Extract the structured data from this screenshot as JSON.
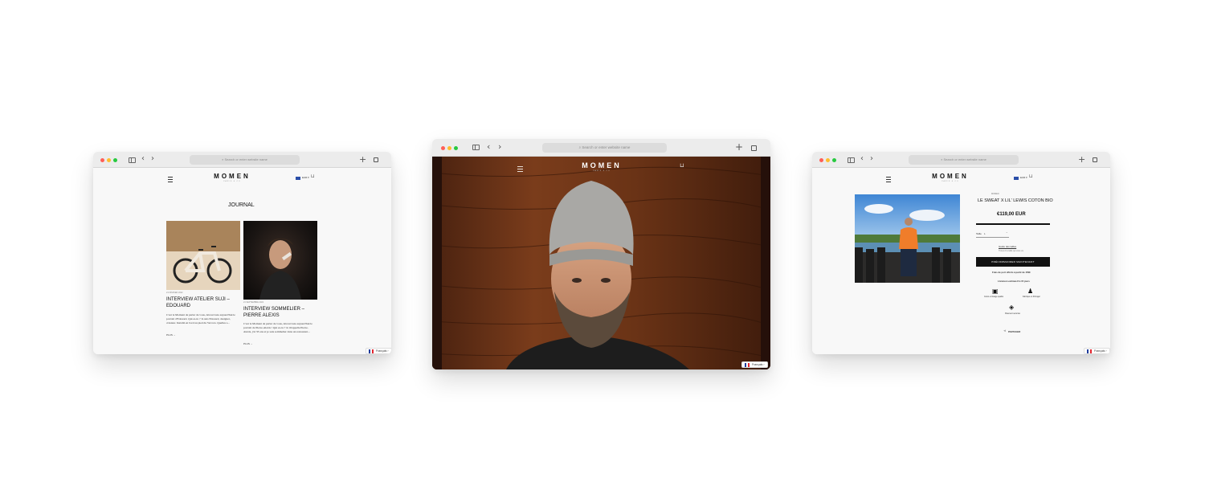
{
  "browser": {
    "url_placeholder": "Search or enter website name",
    "back_icon": "chevron-left-icon",
    "forward_icon": "chevron-right-icon",
    "new_tab_icon": "plus-icon",
    "tabs_icon": "tabs-overview-icon"
  },
  "brand": {
    "name": "MOMEN",
    "tagline": "PARIS & CO"
  },
  "header": {
    "currency": "EUR ▾"
  },
  "language": {
    "label": "Français",
    "chevron": "›"
  },
  "colors": {
    "accent": "#111111",
    "wood": "#6b3418",
    "sky": "#4d8fd6"
  },
  "journal": {
    "title": "JOURNAL",
    "articles": [
      {
        "date": "21 FÉVRIER 2022",
        "title": "INTERVIEW ATELIER SUJI – EDOUARD",
        "excerpt": "C'est le Moment de parler de vous, découvrons aujourd'hui le portrait d'Edouard. Qui es-tu ? Je suis Edouard, designer, créateur. Installé en bord au pied du Vercors. Quelles s...",
        "more": "PLUS →"
      },
      {
        "date": "21 SEPTEMBRE 2021",
        "title": "INTERVIEW SOMMELIER – PIERRE ALEXIS",
        "excerpt": "C'est le Moment de parler de vous, découvrons aujourd'hui le portrait de Pierre-Alexis ! Qui es-tu ? Je m'appelle Pierre-Alexis, j'ai 33 ans et je suis sommelier dans un restaurant...",
        "more": "PLUS →"
      }
    ]
  },
  "product": {
    "vendor": "MOMEN",
    "title": "LE SWEAT X LIL' LEWIS COTON BIO",
    "price": "€119,00 EUR",
    "size_label": "Taille",
    "size_value": "L",
    "size_guide": "Guide des tailles",
    "size_note": "Trouvez la taille qui vous va",
    "cta": "PRÉCOMMANDER MAINTENANT",
    "shipping": "Frais de port offerts à partir de 150€",
    "delivery": "Livraison estimée 8 à 15 jours",
    "features": [
      "Coton et tissage qualité",
      "Fabriqué en Portugal",
      "Paiement sécurisé"
    ],
    "share": "PARTAGER"
  }
}
